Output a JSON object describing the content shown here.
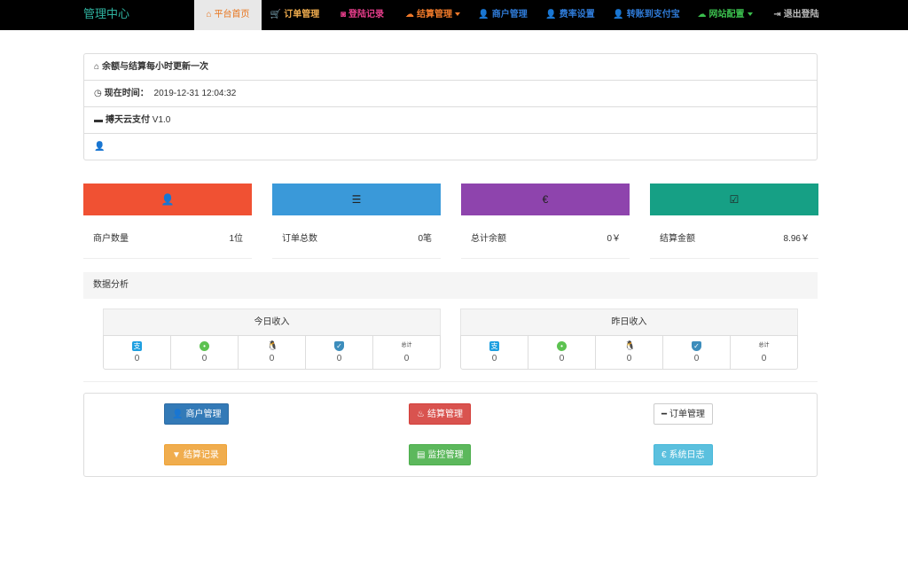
{
  "nav": {
    "brand": "管理中心",
    "items": [
      {
        "label": "平台首页",
        "icon": "home-icon",
        "glyph": "⌂",
        "color": "#e8741c",
        "active": true,
        "caret": false
      },
      {
        "label": "订单管理",
        "icon": "cart-icon",
        "glyph": "🛒",
        "color": "#f0ad4e",
        "active": false,
        "caret": false
      },
      {
        "label": "登陆记录",
        "icon": "camera-icon",
        "glyph": "◙",
        "color": "#e83e8c",
        "active": false,
        "caret": false
      },
      {
        "label": "结算管理",
        "icon": "cloud-icon",
        "glyph": "☁",
        "color": "#f07a2a",
        "active": false,
        "caret": true
      },
      {
        "label": "商户管理",
        "icon": "user-icon",
        "glyph": "👤",
        "color": "#2f7bd8",
        "active": false,
        "caret": false
      },
      {
        "label": "费率设置",
        "icon": "user-icon",
        "glyph": "👤",
        "color": "#2f7bd8",
        "active": false,
        "caret": false
      },
      {
        "label": "转账到支付宝",
        "icon": "user-icon",
        "glyph": "👤",
        "color": "#2f7bd8",
        "active": false,
        "caret": false
      },
      {
        "label": "网站配置",
        "icon": "cloud-icon",
        "glyph": "☁",
        "color": "#3bbf4e",
        "active": false,
        "caret": true
      },
      {
        "label": "退出登陆",
        "icon": "logout-icon",
        "glyph": "⇥",
        "color": "#bbbbbb",
        "active": false,
        "caret": false
      }
    ]
  },
  "info": {
    "notice": "余额与结算每小时更新一次",
    "time_label": "现在时间：",
    "time_value": "2019-12-31 12:04:32",
    "product_name": "搏天云支付",
    "product_version": " V1.0"
  },
  "stats": [
    {
      "label": "商户数量",
      "value": "1位",
      "color": "#f05133",
      "icon": "user-icon",
      "glyph": "👤"
    },
    {
      "label": "订单总数",
      "value": "0笔",
      "color": "#3a99d9",
      "icon": "list-icon",
      "glyph": "☰"
    },
    {
      "label": "总计余额",
      "value": "0￥",
      "color": "#8e44ad",
      "icon": "euro-icon",
      "glyph": "€"
    },
    {
      "label": "结算金额",
      "value": "8.96￥",
      "color": "#16a085",
      "icon": "check-icon",
      "glyph": "☑"
    }
  ],
  "analysis": {
    "title": "数据分析",
    "today": {
      "title": "今日收入",
      "cells": [
        {
          "icon": "alipay-icon",
          "glyph": "支",
          "value": "0"
        },
        {
          "icon": "wechat-icon",
          "glyph": "•",
          "value": "0"
        },
        {
          "icon": "qq-icon",
          "glyph": "🐧",
          "value": "0"
        },
        {
          "icon": "shield-icon",
          "glyph": "✓",
          "value": "0"
        },
        {
          "icon": "total-icon",
          "glyph": "总计",
          "value": "0"
        }
      ]
    },
    "yesterday": {
      "title": "昨日收入",
      "cells": [
        {
          "icon": "alipay-icon",
          "glyph": "支",
          "value": "0"
        },
        {
          "icon": "wechat-icon",
          "glyph": "•",
          "value": "0"
        },
        {
          "icon": "qq-icon",
          "glyph": "🐧",
          "value": "0"
        },
        {
          "icon": "shield-icon",
          "glyph": "✓",
          "value": "0"
        },
        {
          "icon": "total-icon",
          "glyph": "总计",
          "value": "0"
        }
      ]
    }
  },
  "actions": {
    "merchant": "商户管理",
    "settlement": "结算管理",
    "orders": "订单管理",
    "settle_records": "结算记录",
    "monitor": "监控管理",
    "logs": "系统日志"
  }
}
